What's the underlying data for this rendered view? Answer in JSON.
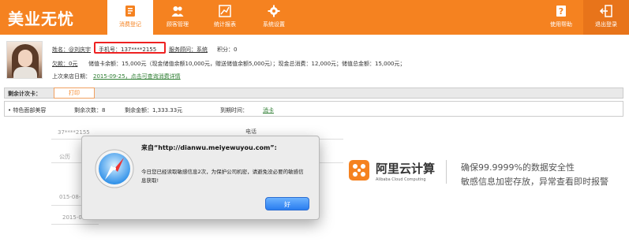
{
  "app": {
    "title": "美业无忧"
  },
  "nav": {
    "items": [
      {
        "label": "消费登记",
        "active": true
      },
      {
        "label": "顾客管理"
      },
      {
        "label": "统计报表"
      },
      {
        "label": "系统设置"
      }
    ],
    "right": [
      {
        "label": "使用帮助"
      },
      {
        "label": "退出登录"
      }
    ]
  },
  "customer": {
    "name": "姓名：@刘庆宇",
    "phone": "手机号：137****2155",
    "consultant": "服务顾问：系统",
    "points": "积分：0",
    "debt": "欠款：0元",
    "balance": "储值卡余额：15,000元（现金储值余额10,000元，赠送储值余额5,000元）；现金总消费：12,000元；储值总金额：15,000元；",
    "last_visit_label": "上次来店日期：",
    "last_visit_link": "2015-09-25，点击可查询消费详情"
  },
  "count_card": {
    "title": "剩余计次卡：",
    "print_label": "打印",
    "row": {
      "item": "• 特色面部美容",
      "remaining_count": "剩余次数：8",
      "remaining_amount": "剩余金额：1,333.33元",
      "expiry": "到期时间：",
      "action": "消卡"
    }
  },
  "background": {
    "phone_fragment": "37****2155",
    "phone_label": "电话",
    "company_fragment": "公历",
    "date_fragment": "015-08-",
    "misc_fragment": "2015-08"
  },
  "ad": {
    "brand": "阿里云计算",
    "brand_en": "Alibaba Cloud Computing",
    "line1": "确保99.9999%的数据安全性",
    "line2": "敏感信息加密存放，异常查看即时报警"
  },
  "dialog": {
    "title": "来自“http://dianwu.meiyewuyou.com”:",
    "message": "今日您已经读取敏感信息2次，为保护公司机密，请避免没必要的敏感信息获取!",
    "ok_label": "好"
  },
  "colors": {
    "accent": "#f58220",
    "phone_highlight": "#e22222",
    "link": "#2e7d32"
  }
}
